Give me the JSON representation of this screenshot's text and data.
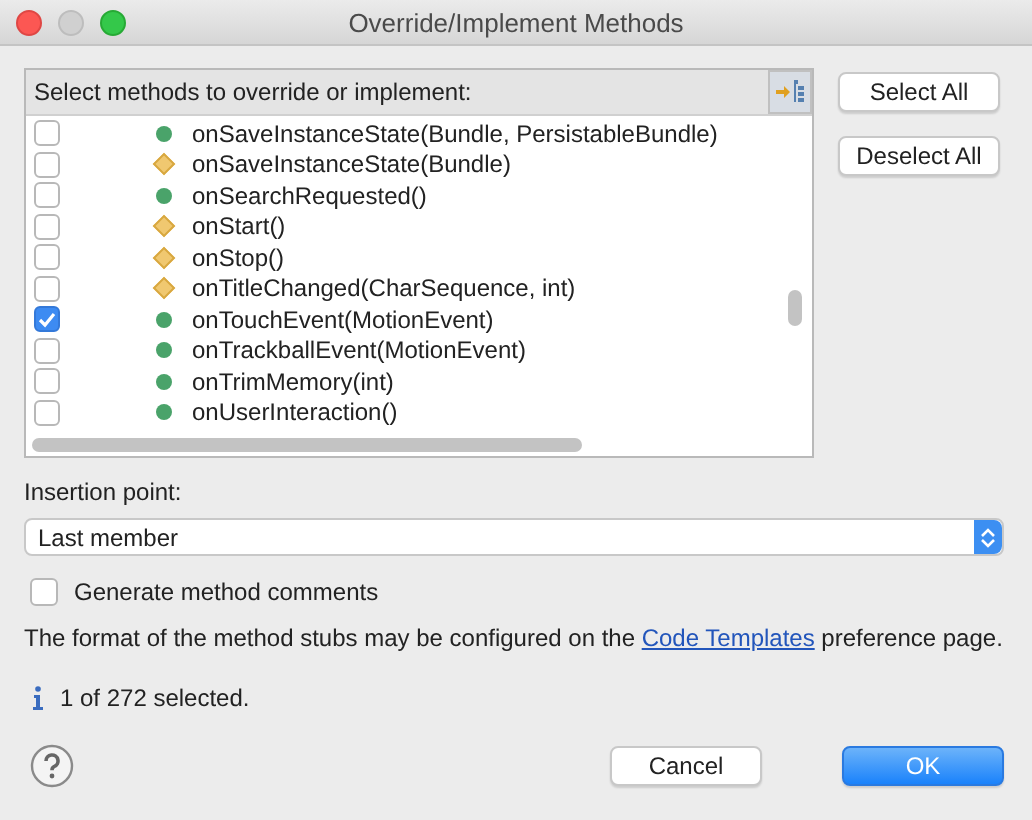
{
  "window": {
    "title": "Override/Implement Methods"
  },
  "methods_panel": {
    "label": "Select methods to override or implement:"
  },
  "methods": [
    {
      "name": "onSaveInstanceState(Bundle, PersistableBundle)",
      "kind": "public",
      "checked": false
    },
    {
      "name": "onSaveInstanceState(Bundle)",
      "kind": "protected",
      "checked": false
    },
    {
      "name": "onSearchRequested()",
      "kind": "public",
      "checked": false
    },
    {
      "name": "onStart()",
      "kind": "protected",
      "checked": false
    },
    {
      "name": "onStop()",
      "kind": "protected",
      "checked": false
    },
    {
      "name": "onTitleChanged(CharSequence, int)",
      "kind": "protected",
      "checked": false
    },
    {
      "name": "onTouchEvent(MotionEvent)",
      "kind": "public",
      "checked": true
    },
    {
      "name": "onTrackballEvent(MotionEvent)",
      "kind": "public",
      "checked": false
    },
    {
      "name": "onTrimMemory(int)",
      "kind": "public",
      "checked": false
    },
    {
      "name": "onUserInteraction()",
      "kind": "public",
      "checked": false
    }
  ],
  "side_buttons": [
    "Select All",
    "Deselect All"
  ],
  "insertion_point": {
    "label": "Insertion point:",
    "value": "Last member"
  },
  "generate_comments": {
    "label": "Generate method comments",
    "checked": false
  },
  "info_text": {
    "before": "The format of the method stubs may be configured on the",
    "link": "Code Templates",
    "after": "preference page."
  },
  "status": "1 of 272 selected.",
  "buttons": [
    {
      "label": "Cancel",
      "default": false
    },
    {
      "label": "OK",
      "default": true
    }
  ]
}
